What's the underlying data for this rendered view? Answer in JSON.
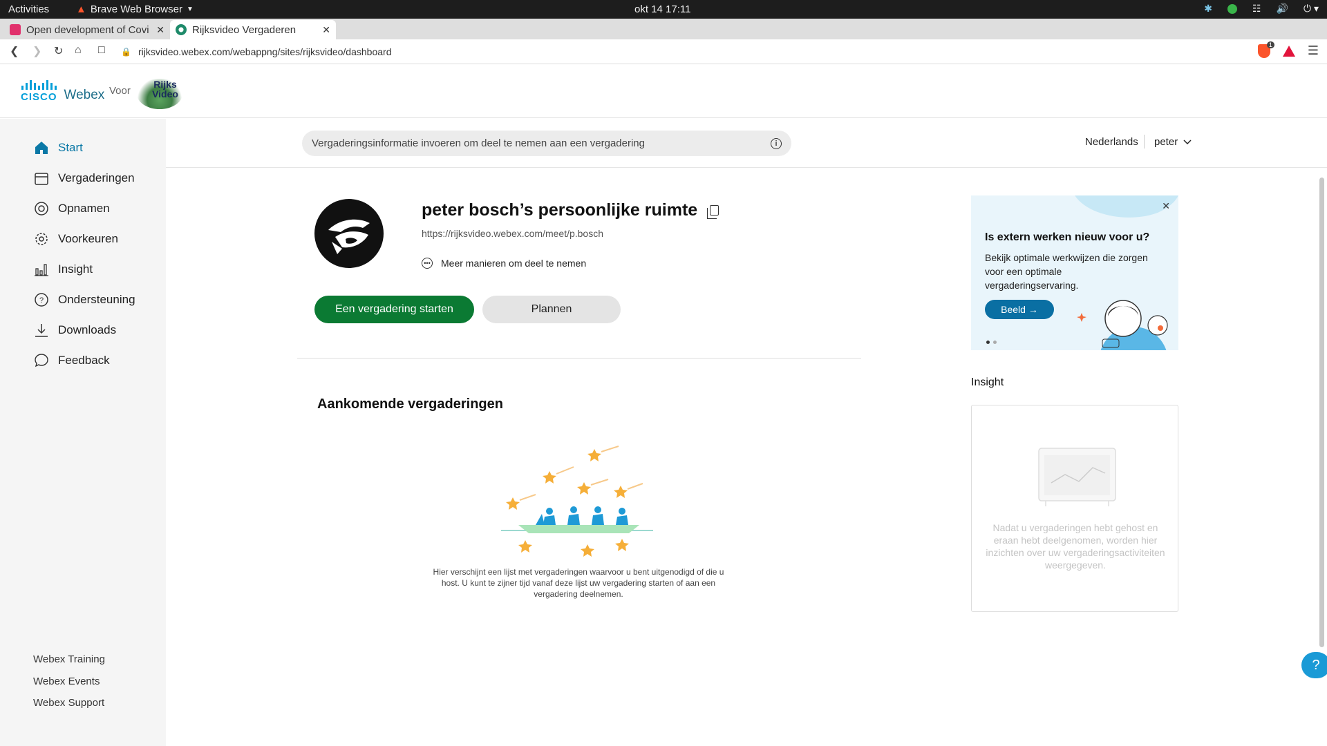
{
  "system": {
    "activities": "Activities",
    "app_name": "Brave Web Browser",
    "clock": "okt 14  17:11"
  },
  "browser": {
    "tabs": [
      {
        "title": "Open development of Covi",
        "favicon_color": "#e1306c"
      },
      {
        "title": "Rijksvideo Vergaderen",
        "favicon_color": "#1e8a6a"
      }
    ],
    "url": "rijksvideo.webex.com/webappng/sites/rijksvideo/dashboard",
    "shield_badge": "1"
  },
  "header": {
    "cisco": "CISCO",
    "webex": "Webex",
    "voor": "Voor",
    "partner": "Rijks Video"
  },
  "sidebar": {
    "items": [
      {
        "label": "Start",
        "icon": "home-icon",
        "active": true
      },
      {
        "label": "Vergaderingen",
        "icon": "calendar-icon"
      },
      {
        "label": "Opnamen",
        "icon": "record-icon"
      },
      {
        "label": "Voorkeuren",
        "icon": "gear-icon"
      },
      {
        "label": "Insight",
        "icon": "bar-chart-icon"
      },
      {
        "label": "Ondersteuning",
        "icon": "help-circle-icon"
      },
      {
        "label": "Downloads",
        "icon": "download-icon"
      },
      {
        "label": "Feedback",
        "icon": "chat-icon"
      }
    ],
    "footer": [
      "Webex Training",
      "Webex Events",
      "Webex Support"
    ]
  },
  "topbar": {
    "search_placeholder": "Vergaderingsinformatie invoeren om deel te nemen aan een vergadering",
    "language": "Nederlands",
    "user": "peter"
  },
  "room": {
    "title": "peter bosch’s persoonlijke ruimte",
    "url": "https://rijksvideo.webex.com/meet/p.bosch",
    "more_ways": "Meer manieren om deel te nemen",
    "start_button": "Een vergadering starten",
    "plan_button": "Plannen"
  },
  "upcoming": {
    "title": "Aankomende vergaderingen",
    "empty_text": "Hier verschijnt een lijst met vergaderingen waarvoor u bent uitgenodigd of die u host. U kunt te zijner tijd vanaf deze lijst uw vergadering starten of aan een vergadering deelnemen."
  },
  "promo": {
    "title": "Is extern werken nieuw voor u?",
    "body": "Bekijk optimale werkwijzen die zorgen voor een optimale vergaderingservaring.",
    "button": "Beeld →"
  },
  "insight": {
    "title": "Insight",
    "empty_text": "Nadat u vergaderingen hebt gehost en eraan hebt deelgenomen, worden hier inzichten over uw vergaderingsactiviteiten weergegeven."
  },
  "colors": {
    "accent": "#0a78a6",
    "start_green": "#0b7a33",
    "promo_bg": "#e9f5fb"
  }
}
